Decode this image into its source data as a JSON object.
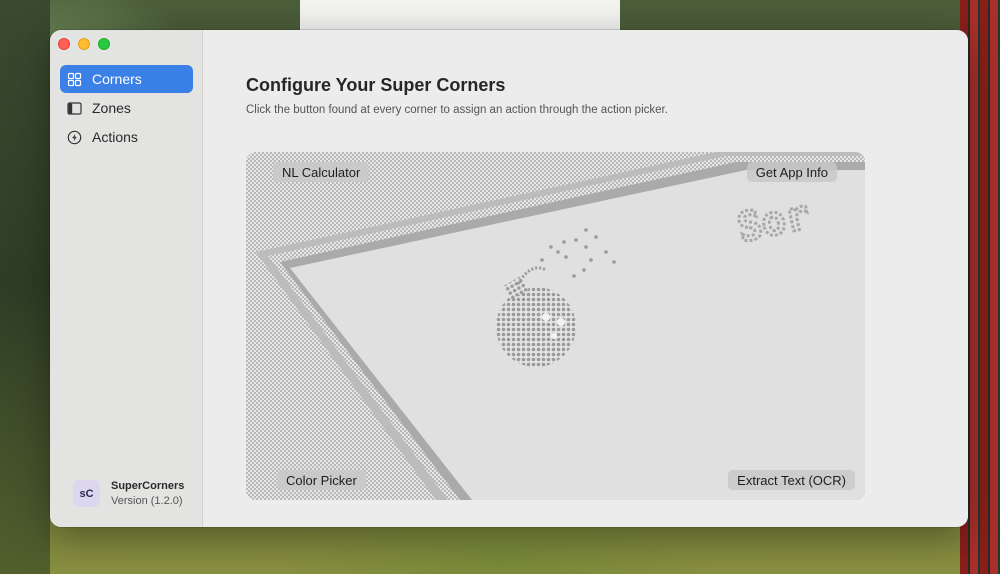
{
  "sidebar": {
    "items": [
      {
        "label": "Corners",
        "icon": "grid-icon",
        "active": true
      },
      {
        "label": "Zones",
        "icon": "sidebar-layout-icon",
        "active": false
      },
      {
        "label": "Actions",
        "icon": "bolt-icon",
        "active": false
      }
    ],
    "app": {
      "logo": "sC",
      "name": "SuperCorners",
      "version": "Version (1.2.0)"
    }
  },
  "main": {
    "title": "Configure Your Super Corners",
    "subtitle": "Click the button found at every corner to assign an action through the action picker.",
    "corners": {
      "top_left": "NL Calculator",
      "top_right": "Get App Info",
      "bottom_left": "Color Picker",
      "bottom_right": "Extract Text (OCR)"
    },
    "preview_fragment_text": "Sor"
  },
  "colors": {
    "accent": "#3b80e6",
    "close": "#fe5f57",
    "minimize": "#febc2e",
    "maximize": "#28c840"
  }
}
